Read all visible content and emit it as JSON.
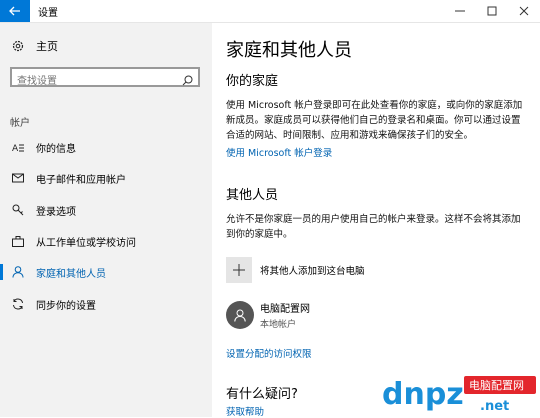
{
  "window": {
    "title": "设置"
  },
  "sidebar": {
    "home_label": "主页",
    "search_placeholder": "查找设置",
    "section": "帐户",
    "items": [
      {
        "label": "你的信息",
        "icon": "person-card-icon",
        "active": false
      },
      {
        "label": "电子邮件和应用帐户",
        "icon": "mail-icon",
        "active": false
      },
      {
        "label": "登录选项",
        "icon": "key-icon",
        "active": false
      },
      {
        "label": "从工作单位或学校访问",
        "icon": "briefcase-icon",
        "active": false
      },
      {
        "label": "家庭和其他人员",
        "icon": "person-icon",
        "active": true
      },
      {
        "label": "同步你的设置",
        "icon": "sync-icon",
        "active": false
      }
    ]
  },
  "main": {
    "title": "家庭和其他人员",
    "family_heading": "你的家庭",
    "family_text": "使用 Microsoft 帐户登录即可在此处查看你的家庭，或向你的家庭添加新成员。家庭成员可以获得他们自己的登录名和桌面。你可以通过设置合适的网站、时间限制、应用和游戏来确保孩子们的安全。",
    "family_link": "使用 Microsoft 帐户登录",
    "others_heading": "其他人员",
    "others_text": "允许不是你家庭一员的用户使用自己的帐户来登录。这样不会将其添加到你的家庭中。",
    "add_label": "将其他人添加到这台电脑",
    "user_name": "电脑配置网",
    "user_type": "本地帐户",
    "assigned_access_link": "设置分配的访问权限",
    "question_heading": "有什么疑问?",
    "help_link": "获取帮助"
  },
  "watermark": {
    "brand": "dnpz",
    "suffix": ".net",
    "tag": "电脑配置网"
  },
  "colors": {
    "accent": "#0078d7",
    "link": "#0063b1",
    "sidebar_bg": "#f2f2f2"
  }
}
